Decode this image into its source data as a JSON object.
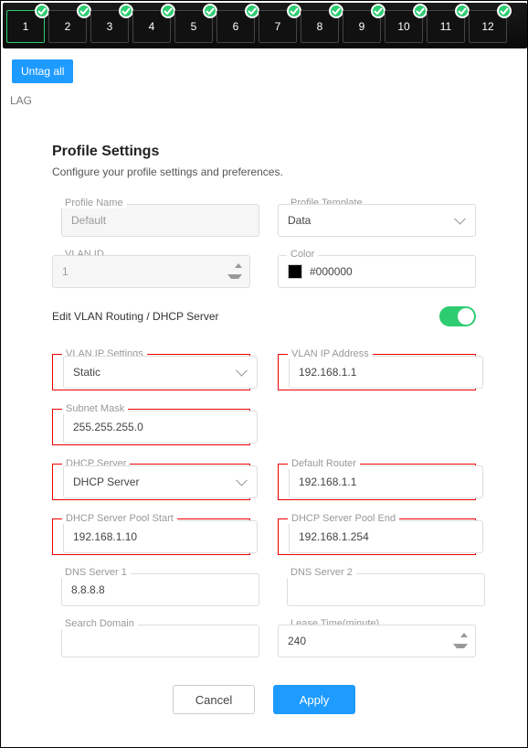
{
  "ports": {
    "labels": [
      "1",
      "2",
      "3",
      "4",
      "5",
      "6",
      "7",
      "8",
      "9",
      "10",
      "11",
      "12"
    ],
    "selected_index": 0
  },
  "toolbar": {
    "untag_all_label": "Untag all"
  },
  "lag_label": "LAG",
  "settings": {
    "heading": "Profile Settings",
    "subheading": "Configure your profile settings and preferences.",
    "profile_name": {
      "label": "Profile Name",
      "value": "Default"
    },
    "profile_template": {
      "label": "Profile Template",
      "value": "Data"
    },
    "vlan_id": {
      "label": "VLAN ID",
      "value": "1"
    },
    "color": {
      "label": "Color",
      "value": "#000000"
    },
    "edit_vlan_label": "Edit VLAN Routing / DHCP Server",
    "edit_vlan_enabled": true,
    "vlan_ip_settings": {
      "label": "VLAN IP Settings",
      "value": "Static"
    },
    "vlan_ip_address": {
      "label": "VLAN IP Address",
      "value": "192.168.1.1"
    },
    "subnet_mask": {
      "label": "Subnet Mask",
      "value": "255.255.255.0"
    },
    "dhcp_server": {
      "label": "DHCP Server",
      "value": "DHCP Server"
    },
    "default_router": {
      "label": "Default Router",
      "value": "192.168.1.1"
    },
    "pool_start": {
      "label": "DHCP Server Pool Start",
      "value": "192.168.1.10"
    },
    "pool_end": {
      "label": "DHCP Server Pool End",
      "value": "192.168.1.254"
    },
    "dns1": {
      "label": "DNS Server 1",
      "value": "8.8.8.8"
    },
    "dns2": {
      "label": "DNS Server 2",
      "value": ""
    },
    "search_domain": {
      "label": "Search Domain",
      "value": ""
    },
    "lease_time": {
      "label": "Lease Time(minute)",
      "value": "240"
    }
  },
  "buttons": {
    "cancel": "Cancel",
    "apply": "Apply"
  }
}
